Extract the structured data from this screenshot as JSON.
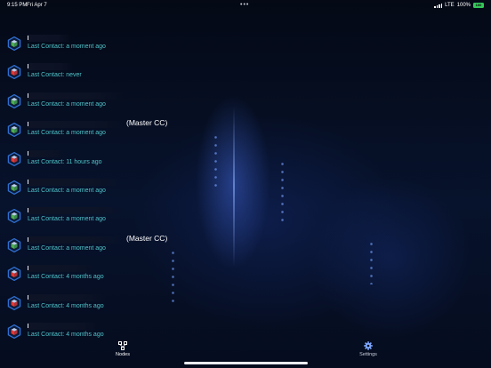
{
  "status_bar": {
    "time": "9:15 PM",
    "date": "Fri Apr 7",
    "network": "LTE",
    "battery_percent": "100%",
    "battery_level": "100"
  },
  "nodes": [
    {
      "status": "online",
      "suffix": "",
      "last_contact": "Last Contact: a moment ago"
    },
    {
      "status": "offline",
      "suffix": "",
      "last_contact": "Last Contact: never"
    },
    {
      "status": "online",
      "suffix": "",
      "last_contact": "Last Contact: a moment ago"
    },
    {
      "status": "online",
      "suffix": "(Master CC)",
      "last_contact": "Last Contact: a moment ago"
    },
    {
      "status": "offline",
      "suffix": "",
      "last_contact": "Last Contact: 11 hours ago"
    },
    {
      "status": "online",
      "suffix": "",
      "last_contact": "Last Contact: a moment ago"
    },
    {
      "status": "online",
      "suffix": "",
      "last_contact": "Last Contact: a moment ago"
    },
    {
      "status": "online",
      "suffix": "(Master CC)",
      "last_contact": "Last Contact: a moment ago"
    },
    {
      "status": "offline",
      "suffix": "",
      "last_contact": "Last Contact: 4 months ago"
    },
    {
      "status": "offline",
      "suffix": "",
      "last_contact": "Last Contact: 4 months ago"
    },
    {
      "status": "offline",
      "suffix": "",
      "last_contact": "Last Contact: 4 months ago"
    }
  ],
  "tab_bar": {
    "nodes_label": "Nodes",
    "settings_label": "Settings",
    "selected": "Nodes"
  },
  "colors": {
    "online": "#4caf50",
    "offline": "#e53935",
    "hex_outline": "#2f6fd1",
    "contact_text": "#4fc3c9"
  },
  "icons": {
    "online": "hex-cube-green-icon",
    "offline": "hex-cube-red-icon",
    "nodes_tab": "nodes-network-icon",
    "settings_tab": "gear-icon"
  }
}
